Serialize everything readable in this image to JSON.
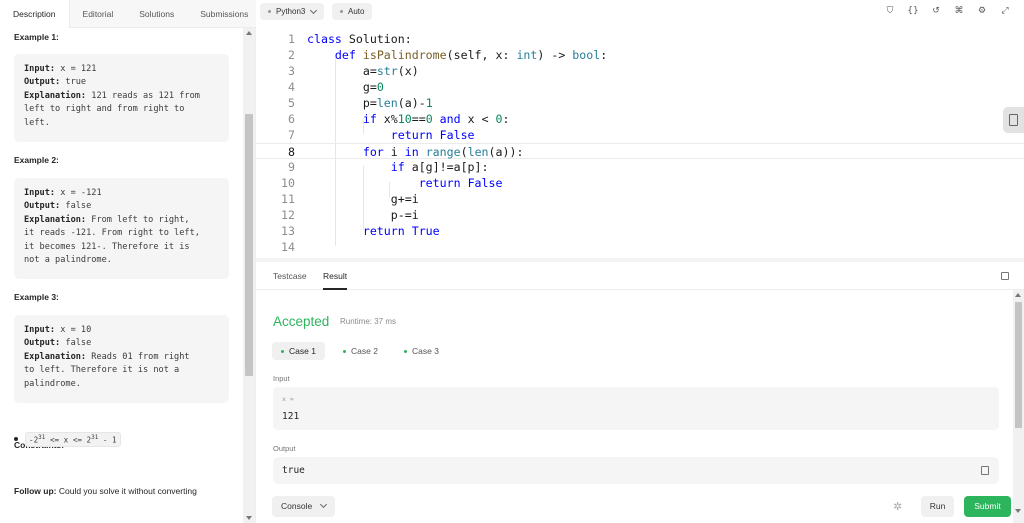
{
  "tabs": [
    "Description",
    "Editorial",
    "Solutions",
    "Submissions"
  ],
  "description": {
    "examples": [
      {
        "title": "Example 1:",
        "input_label": "Input:",
        "input": " x = 121",
        "output_label": "Output:",
        "output": " true",
        "explanation_label": "Explanation:",
        "explanation_lines": [
          " 121 reads as 121 from",
          "left to right and from right to",
          "left."
        ]
      },
      {
        "title": "Example 2:",
        "input_label": "Input:",
        "input": " x = -121",
        "output_label": "Output:",
        "output": " false",
        "explanation_label": "Explanation:",
        "explanation_lines": [
          " From left to right,",
          "it reads -121. From right to left,",
          "it becomes 121-. Therefore it is",
          "not a palindrome."
        ]
      },
      {
        "title": "Example 3:",
        "input_label": "Input:",
        "input": " x = 10",
        "output_label": "Output:",
        "output": " false",
        "explanation_label": "Explanation:",
        "explanation_lines": [
          " Reads 01 from right",
          "to left. Therefore it is not a",
          "palindrome."
        ]
      }
    ],
    "constraints_title": "Constraints:",
    "constraint_pre": "-2",
    "constraint_exp1": "31",
    "constraint_mid": " <= x <= 2",
    "constraint_exp2": "31",
    "constraint_post": " - 1",
    "followup_label": "Follow up:",
    "followup_text": " Could you solve it without converting"
  },
  "editor": {
    "language": "Python3",
    "mode": "Auto",
    "icons": [
      "bookmark-icon",
      "braces-icon",
      "reset-icon",
      "command-icon",
      "settings-icon",
      "expand-icon"
    ],
    "current_line": 8,
    "lines": [
      "class Solution:",
      "    def isPalindrome(self, x: int) -> bool:",
      "        a=str(x)",
      "        g=0",
      "        p=len(a)-1",
      "        if x%10==0 and x < 0:",
      "            return False",
      "        for i in range(len(a)):",
      "            if a[g]!=a[p]:",
      "                return False",
      "            g+=i",
      "            p-=i",
      "        return True",
      ""
    ]
  },
  "bottom": {
    "tabs": [
      "Testcase",
      "Result"
    ],
    "active_tab": "Result",
    "status": "Accepted",
    "runtime": "Runtime: 37 ms",
    "cases": [
      "Case 1",
      "Case 2",
      "Case 3"
    ],
    "input_label": "Input",
    "input_var": "x =",
    "input_value": "121",
    "output_label": "Output",
    "output_value": "true",
    "console_label": "Console",
    "run_label": "Run",
    "submit_label": "Submit"
  },
  "colors": {
    "accent_green": "#2db55d",
    "keyword": "#0000ff",
    "number": "#098658",
    "function": "#795e26",
    "builtin": "#267f99"
  }
}
